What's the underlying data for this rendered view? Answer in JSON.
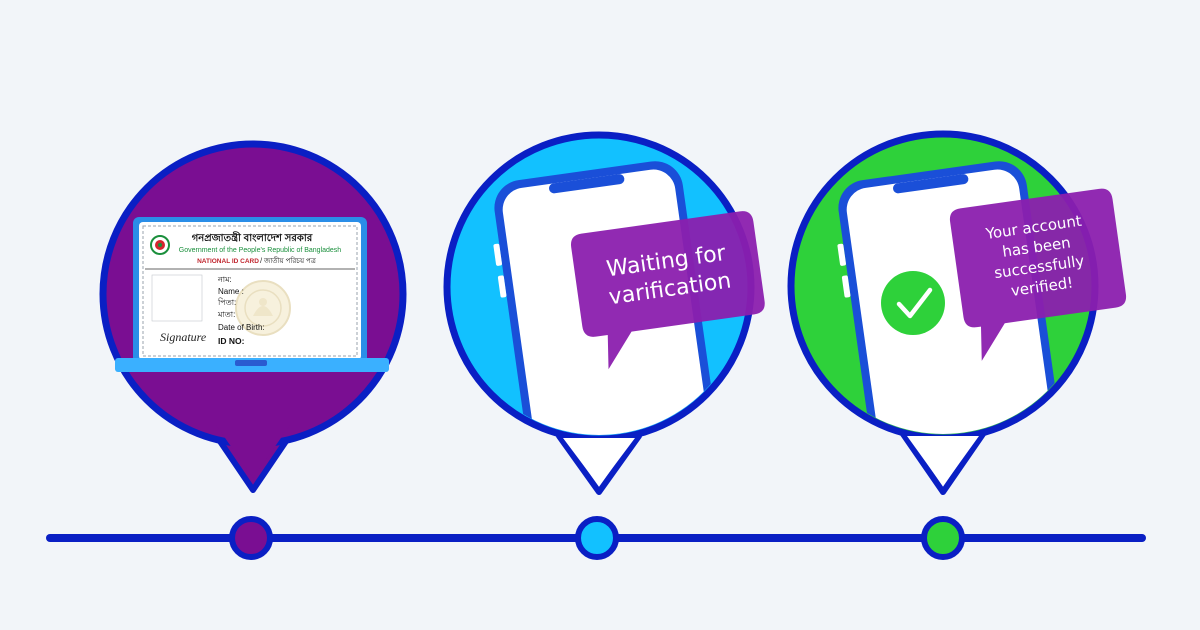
{
  "colors": {
    "background": "#f2f5f9",
    "line": "#0a1fc4",
    "purple": "#7a0e92",
    "cyan": "#12c1ff",
    "green": "#2ed13a",
    "bubble": "#8b1fae",
    "white": "#ffffff"
  },
  "steps": [
    {
      "name": "step-id-card",
      "dot_color": "#7a0e92"
    },
    {
      "name": "step-waiting",
      "dot_color": "#12c1ff"
    },
    {
      "name": "step-verified",
      "dot_color": "#2ed13a"
    }
  ],
  "id_card": {
    "header_bn": "গনপ্রজাতন্ত্রী বাংলাদেশ সরকার",
    "header_en": "Government of the People's Republic of Bangladesh",
    "card_label": "NATIONAL ID CARD",
    "card_label_bn": "/ জাতীয় পরিচয় পত্র",
    "field_name_bn": "নাম:",
    "field_name": "Name :",
    "field_father": "পিতা:",
    "field_mother": "মাতা:",
    "field_dob": "Date of Birth:",
    "field_id": "ID NO:",
    "signature": "Signature"
  },
  "waiting_message": {
    "line1": "Waiting for",
    "line2": "varification"
  },
  "verified_message": {
    "line1": "Your account",
    "line2": "has been",
    "line3": "successfully",
    "line4": "verified!"
  },
  "icons": {
    "checkmark": "check-icon",
    "emblem": "bangladesh-emblem-icon",
    "seal": "national-seal-icon"
  }
}
